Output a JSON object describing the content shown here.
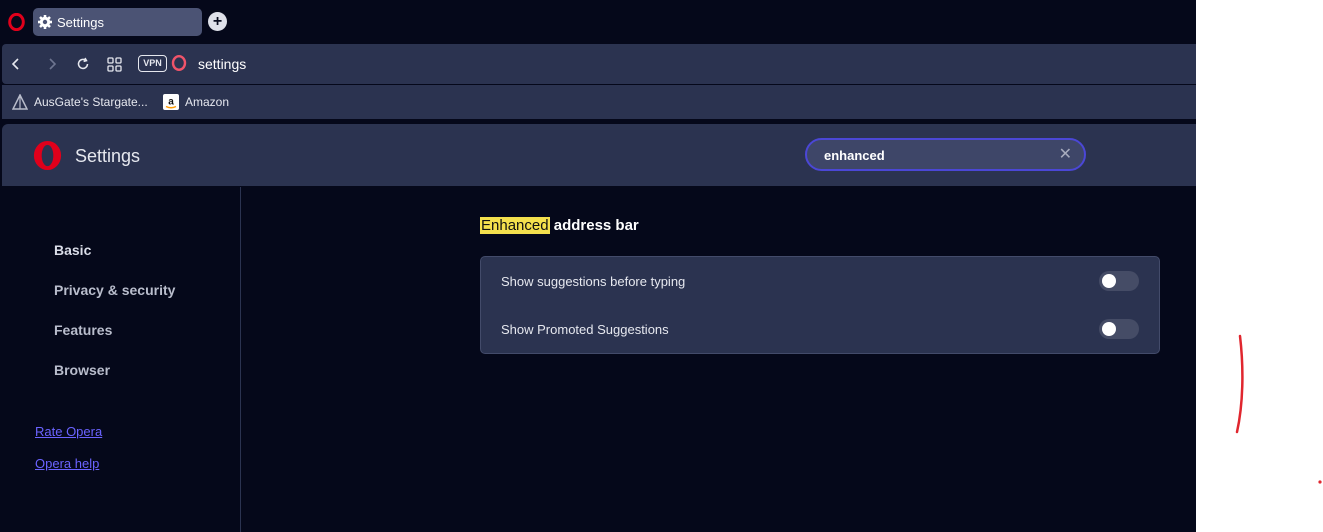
{
  "tabs": [
    {
      "title": "Settings",
      "icon": "gear-icon"
    }
  ],
  "address_bar": {
    "vpn_label": "VPN",
    "url": "settings"
  },
  "bookmarks": [
    {
      "label": "AusGate's Stargate...",
      "icon": "ausgate-icon"
    },
    {
      "label": "Amazon",
      "icon": "amazon-icon"
    }
  ],
  "header": {
    "title": "Settings"
  },
  "search": {
    "value": "enhanced",
    "clear_glyph": "✕"
  },
  "sidebar": {
    "items": [
      {
        "label": "Basic"
      },
      {
        "label": "Privacy & security"
      },
      {
        "label": "Features"
      },
      {
        "label": "Browser"
      }
    ],
    "links": [
      {
        "label": "Rate Opera"
      },
      {
        "label": "Opera help"
      }
    ]
  },
  "section": {
    "title_highlight": "Enhanced",
    "title_rest": " address bar",
    "rows": [
      {
        "label": "Show suggestions before typing",
        "enabled": false
      },
      {
        "label": "Show Promoted Suggestions",
        "enabled": false
      }
    ]
  },
  "colors": {
    "accent": "#4b47d6",
    "highlight": "#f4e04d",
    "link": "#6b63ff",
    "opera_red": "#e0001b",
    "annotation": "#e0262e"
  }
}
